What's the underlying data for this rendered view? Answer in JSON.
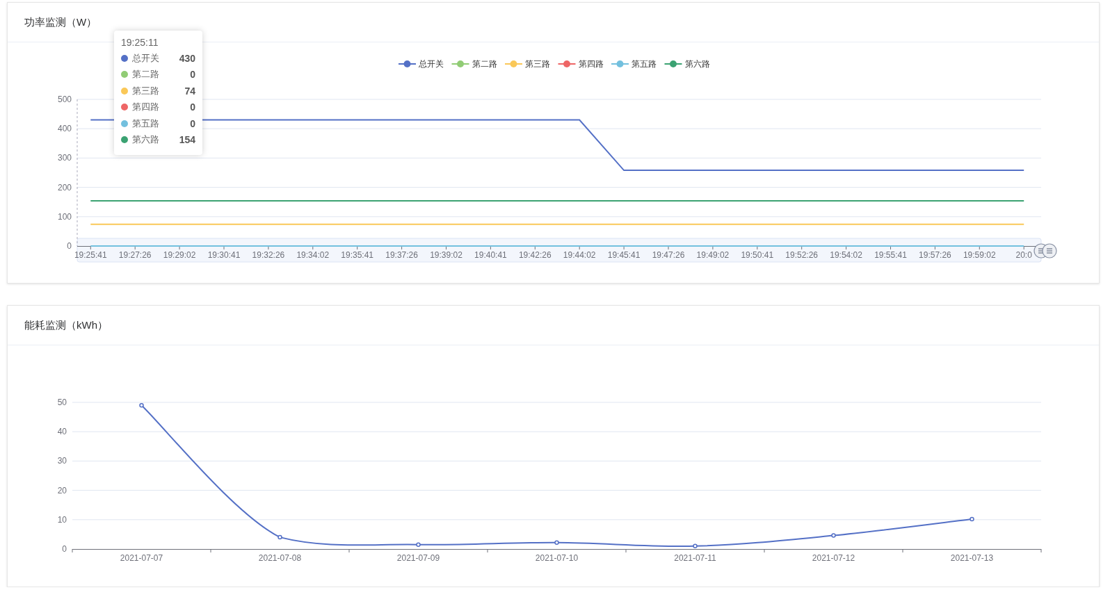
{
  "power_card": {
    "title": "功率监测（W）",
    "chart_data": {
      "type": "line",
      "categories": [
        "19:25:41",
        "19:27:26",
        "19:29:02",
        "19:30:41",
        "19:32:26",
        "19:34:02",
        "19:35:41",
        "19:37:26",
        "19:39:02",
        "19:40:41",
        "19:42:26",
        "19:44:02",
        "19:45:41",
        "19:47:26",
        "19:49:02",
        "19:50:41",
        "19:52:26",
        "19:54:02",
        "19:55:41",
        "19:57:26",
        "19:59:02",
        "20:0"
      ],
      "series": [
        {
          "name": "总开关",
          "color": "#5470c6",
          "values": [
            430,
            null,
            null,
            430,
            430,
            430,
            430,
            430,
            430,
            430,
            430,
            430,
            258,
            258,
            258,
            258,
            258,
            258,
            258,
            258,
            258,
            258
          ]
        },
        {
          "name": "第二路",
          "color": "#91cc75",
          "values": [
            null,
            null,
            null,
            null,
            null,
            null,
            null,
            null,
            null,
            null,
            null,
            null,
            null,
            null,
            null,
            null,
            null,
            null,
            null,
            null,
            null,
            null
          ]
        },
        {
          "name": "第三路",
          "color": "#fac858",
          "values": [
            74,
            74,
            74,
            74,
            74,
            74,
            74,
            74,
            74,
            74,
            74,
            74,
            74,
            74,
            74,
            74,
            74,
            74,
            74,
            74,
            74,
            74
          ]
        },
        {
          "name": "第四路",
          "color": "#ee6666",
          "values": [
            null,
            null,
            null,
            null,
            null,
            null,
            null,
            null,
            null,
            null,
            null,
            null,
            null,
            null,
            null,
            null,
            null,
            null,
            null,
            null,
            null,
            null
          ]
        },
        {
          "name": "第五路",
          "color": "#73c0de",
          "values": [
            0,
            0,
            0,
            0,
            0,
            0,
            0,
            0,
            0,
            0,
            0,
            0,
            0,
            0,
            0,
            0,
            0,
            0,
            0,
            0,
            0,
            0
          ]
        },
        {
          "name": "第六路",
          "color": "#3ba272",
          "values": [
            154,
            154,
            154,
            154,
            154,
            154,
            154,
            154,
            154,
            154,
            154,
            154,
            154,
            154,
            154,
            154,
            154,
            154,
            154,
            154,
            154,
            154
          ]
        }
      ],
      "ylim": [
        0,
        500
      ],
      "yticks": [
        0,
        100,
        200,
        300,
        400,
        500
      ],
      "grid": true,
      "legend": true
    },
    "tooltip": {
      "time": "19:25:11",
      "rows": [
        {
          "label": "总开关",
          "value": "430",
          "color": "#5470c6"
        },
        {
          "label": "第二路",
          "value": "0",
          "color": "#91cc75"
        },
        {
          "label": "第三路",
          "value": "74",
          "color": "#fac858"
        },
        {
          "label": "第四路",
          "value": "0",
          "color": "#ee6666"
        },
        {
          "label": "第五路",
          "value": "0",
          "color": "#73c0de"
        },
        {
          "label": "第六路",
          "value": "154",
          "color": "#3ba272"
        }
      ]
    }
  },
  "energy_card": {
    "title": "能耗监测（kWh）",
    "chart_data": {
      "type": "line",
      "categories": [
        "2021-07-07",
        "2021-07-08",
        "2021-07-09",
        "2021-07-10",
        "2021-07-11",
        "2021-07-12",
        "2021-07-13"
      ],
      "series": [
        {
          "color": "#5470c6",
          "marker": "circle",
          "values": [
            49,
            4,
            1.5,
            2.2,
            1,
            4.6,
            10.2
          ]
        }
      ],
      "ylim": [
        0,
        50
      ],
      "yticks": [
        0,
        10,
        20,
        30,
        40,
        50
      ],
      "grid": true
    }
  }
}
